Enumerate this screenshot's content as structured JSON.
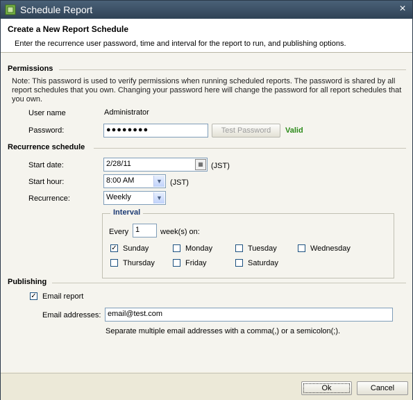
{
  "window": {
    "title": "Schedule Report",
    "close_label": "×"
  },
  "header": {
    "title": "Create a New Report Schedule",
    "subtitle": "Enter the recurrence user password, time and interval for the report to run, and publishing options."
  },
  "permissions": {
    "section_label": "Permissions",
    "note": "Note: This password is used to verify permissions when running scheduled reports. The password is shared by all report schedules that you own. Changing your password here will change the password for all report schedules that you own.",
    "user_name_label": "User name",
    "user_name_value": "Administrator",
    "password_label": "Password:",
    "password_value": "●●●●●●●●",
    "test_button": "Test Password",
    "status": "Valid"
  },
  "recurrence": {
    "section_label": "Recurrence schedule",
    "start_date_label": "Start date:",
    "start_date_value": "2/28/11",
    "start_date_tz": "(JST)",
    "start_hour_label": "Start hour:",
    "start_hour_value": "8:00 AM",
    "start_hour_tz": "(JST)",
    "recurrence_label": "Recurrence:",
    "recurrence_value": "Weekly",
    "interval": {
      "legend": "Interval",
      "every_label": "Every",
      "every_value": "1",
      "unit_label": "week(s) on:",
      "days": [
        {
          "label": "Sunday",
          "checked": true
        },
        {
          "label": "Monday",
          "checked": false
        },
        {
          "label": "Tuesday",
          "checked": false
        },
        {
          "label": "Wednesday",
          "checked": false
        },
        {
          "label": "Thursday",
          "checked": false
        },
        {
          "label": "Friday",
          "checked": false
        },
        {
          "label": "Saturday",
          "checked": false
        }
      ]
    }
  },
  "publishing": {
    "section_label": "Publishing",
    "email_report_label": "Email report",
    "email_report_checked": true,
    "email_addresses_label": "Email addresses:",
    "email_addresses_value": "email@test.com",
    "hint": "Separate multiple email addresses with a comma(,) or a semicolon(;)."
  },
  "footer": {
    "ok_label": "Ok",
    "cancel_label": "Cancel"
  },
  "colors": {
    "titlebar": "#3d5268",
    "valid": "#2a8a18",
    "legend": "#1d3b74"
  }
}
